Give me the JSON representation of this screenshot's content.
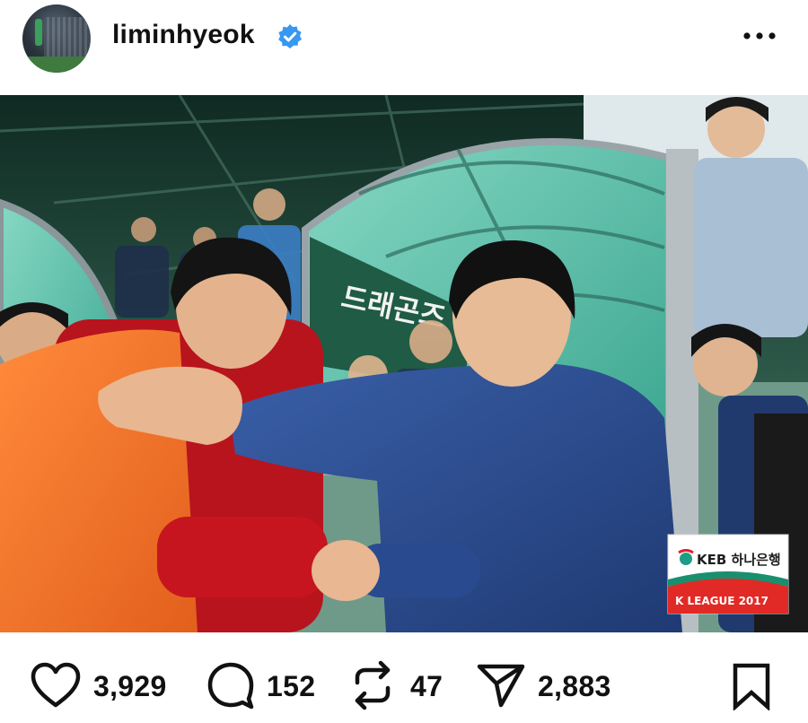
{
  "post": {
    "username": "liminhyeok",
    "verified": true
  },
  "image": {
    "sponsor_line1": "KEB 하나은행",
    "sponsor_line2": "K LEAGUE 2017",
    "banner_text": "드래곤즈"
  },
  "actions": {
    "likes": "3,929",
    "comments": "152",
    "reposts": "47",
    "shares": "2,883"
  },
  "colors": {
    "verified_blue": "#3897f0",
    "text": "#111111",
    "background": "#ffffff"
  },
  "icons": [
    "heart-icon",
    "comment-icon",
    "repost-icon",
    "send-icon",
    "bookmark-icon",
    "more-icon",
    "verified-badge-icon"
  ]
}
